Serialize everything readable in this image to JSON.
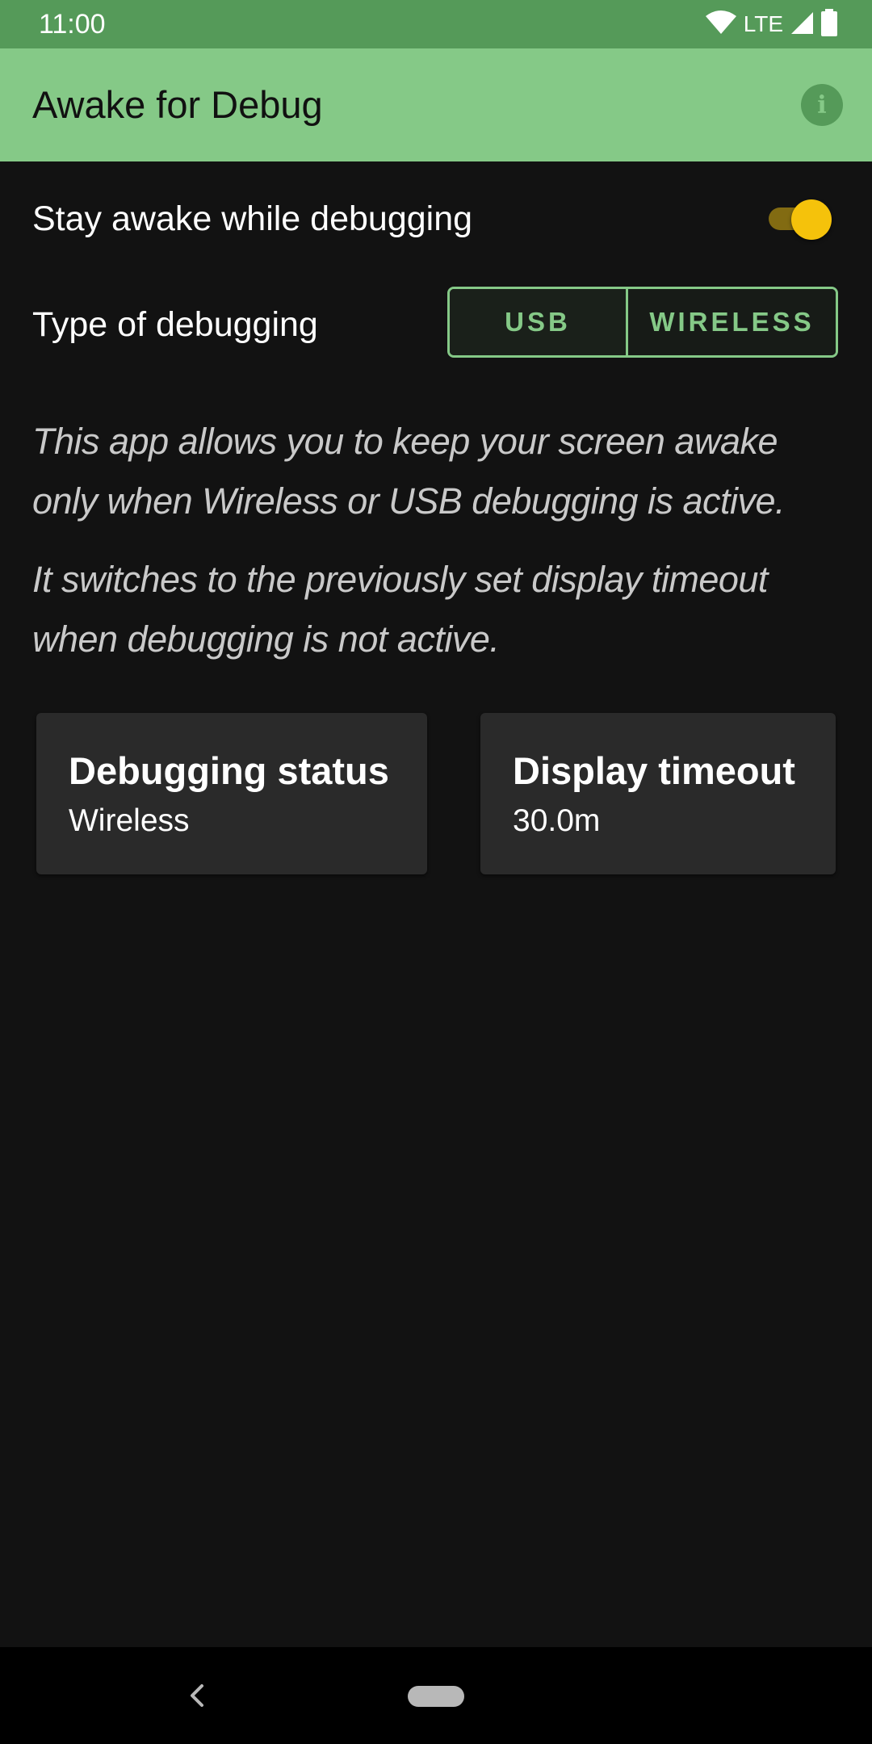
{
  "status_bar": {
    "time": "11:00",
    "network": "LTE",
    "icons": [
      "wifi-icon",
      "signal-icon",
      "battery-icon"
    ]
  },
  "app_bar": {
    "title": "Awake for Debug",
    "info_icon": "info-icon"
  },
  "settings": {
    "stay_awake_label": "Stay awake while debugging",
    "stay_awake_enabled": true,
    "debug_type_label": "Type of debugging",
    "debug_type_options": [
      "USB",
      "WIRELESS"
    ]
  },
  "description": {
    "paragraph1": "This app allows you to keep your screen awake only when Wireless or USB debugging is active.",
    "paragraph2": "It switches to the previously set display timeout when debugging is not active."
  },
  "cards": {
    "debugging_status_title": "Debugging status",
    "debugging_status_value": "Wireless",
    "display_timeout_title": "Display timeout",
    "display_timeout_value": "30.0m"
  },
  "colors": {
    "status_bar": "#559a59",
    "app_bar": "#85c987",
    "accent": "#85c987",
    "toggle_thumb": "#f5c20b",
    "background": "#121212",
    "card": "#2a2a2a"
  }
}
